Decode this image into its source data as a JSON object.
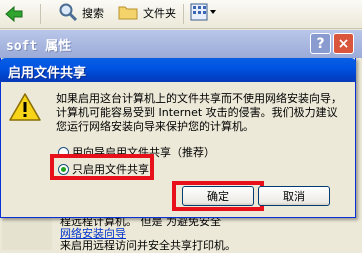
{
  "toolbar": {
    "search_label": "搜索",
    "folders_label": "文件夹"
  },
  "background_window": {
    "title": "soft 属性",
    "help_label": "?",
    "close_label": "×",
    "lines": [
      "程远程计算机。 但是 为避免安全",
      "网络安装向导",
      "来启用远程访问并安全共享打印机。"
    ]
  },
  "dialog": {
    "title": "启用文件共享",
    "message": "如果启用这台计算机上的文件共享而不使用网络安装向导，计算机可能容易受到 Internet 攻击的侵害。我们极力建议您运行网络安装向导来保护您的计算机。",
    "options": [
      {
        "label": "用向导启用文件共享（推荐）",
        "selected": false
      },
      {
        "label": "只启用文件共享",
        "selected": true
      }
    ],
    "ok_label": "确定",
    "cancel_label": "取消"
  },
  "colors": {
    "highlight": "#e8101a",
    "title_blue": "#0054e3"
  }
}
